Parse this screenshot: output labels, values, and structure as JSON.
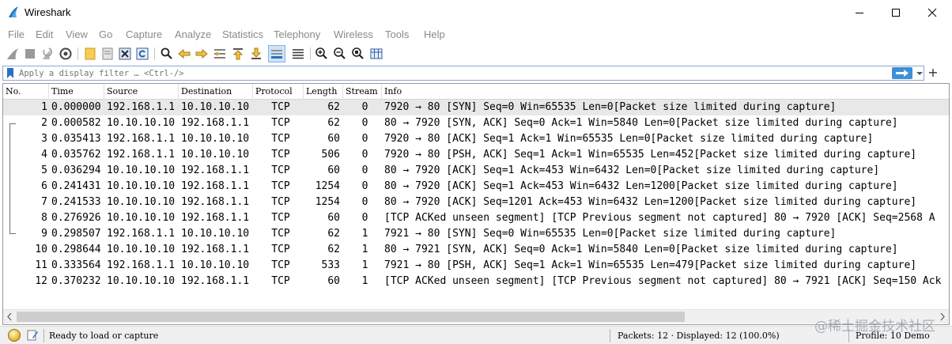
{
  "window": {
    "title": "Wireshark"
  },
  "menu": [
    "File",
    "Edit",
    "View",
    "Go",
    "Capture",
    "Analyze",
    "Statistics",
    "Telephony",
    "Wireless",
    "Tools",
    "Help"
  ],
  "filter": {
    "placeholder": "Apply a display filter … <Ctrl-/>",
    "add_label": "+"
  },
  "columns": {
    "no": "No.",
    "time": "Time",
    "source": "Source",
    "destination": "Destination",
    "protocol": "Protocol",
    "length": "Length",
    "stream": "Stream",
    "info": "Info"
  },
  "packets": [
    {
      "no": "1",
      "time": "0.000000",
      "src": "192.168.1.1",
      "dst": "10.10.10.10",
      "proto": "TCP",
      "len": "62",
      "stream": "0",
      "info": "7920 → 80 [SYN] Seq=0 Win=65535 Len=0[Packet size limited during capture]"
    },
    {
      "no": "2",
      "time": "0.000582",
      "src": "10.10.10.10",
      "dst": "192.168.1.1",
      "proto": "TCP",
      "len": "62",
      "stream": "0",
      "info": "80 → 7920 [SYN, ACK] Seq=0 Ack=1 Win=5840 Len=0[Packet size limited during capture]"
    },
    {
      "no": "3",
      "time": "0.035413",
      "src": "192.168.1.1",
      "dst": "10.10.10.10",
      "proto": "TCP",
      "len": "60",
      "stream": "0",
      "info": "7920 → 80 [ACK] Seq=1 Ack=1 Win=65535 Len=0[Packet size limited during capture]"
    },
    {
      "no": "4",
      "time": "0.035762",
      "src": "192.168.1.1",
      "dst": "10.10.10.10",
      "proto": "TCP",
      "len": "506",
      "stream": "0",
      "info": "7920 → 80 [PSH, ACK] Seq=1 Ack=1 Win=65535 Len=452[Packet size limited during capture]"
    },
    {
      "no": "5",
      "time": "0.036294",
      "src": "10.10.10.10",
      "dst": "192.168.1.1",
      "proto": "TCP",
      "len": "60",
      "stream": "0",
      "info": "80 → 7920 [ACK] Seq=1 Ack=453 Win=6432 Len=0[Packet size limited during capture]"
    },
    {
      "no": "6",
      "time": "0.241431",
      "src": "10.10.10.10",
      "dst": "192.168.1.1",
      "proto": "TCP",
      "len": "1254",
      "stream": "0",
      "info": "80 → 7920 [ACK] Seq=1 Ack=453 Win=6432 Len=1200[Packet size limited during capture]"
    },
    {
      "no": "7",
      "time": "0.241533",
      "src": "10.10.10.10",
      "dst": "192.168.1.1",
      "proto": "TCP",
      "len": "1254",
      "stream": "0",
      "info": "80 → 7920 [ACK] Seq=1201 Ack=453 Win=6432 Len=1200[Packet size limited during capture]"
    },
    {
      "no": "8",
      "time": "0.276926",
      "src": "10.10.10.10",
      "dst": "192.168.1.1",
      "proto": "TCP",
      "len": "60",
      "stream": "0",
      "info": "[TCP ACKed unseen segment] [TCP Previous segment not captured] 80 → 7920 [ACK] Seq=2568 A"
    },
    {
      "no": "9",
      "time": "0.298507",
      "src": "192.168.1.1",
      "dst": "10.10.10.10",
      "proto": "TCP",
      "len": "62",
      "stream": "1",
      "info": "7921 → 80 [SYN] Seq=0 Win=65535 Len=0[Packet size limited during capture]"
    },
    {
      "no": "10",
      "time": "0.298644",
      "src": "10.10.10.10",
      "dst": "192.168.1.1",
      "proto": "TCP",
      "len": "62",
      "stream": "1",
      "info": "80 → 7921 [SYN, ACK] Seq=0 Ack=1 Win=5840 Len=0[Packet size limited during capture]"
    },
    {
      "no": "11",
      "time": "0.333564",
      "src": "192.168.1.1",
      "dst": "10.10.10.10",
      "proto": "TCP",
      "len": "533",
      "stream": "1",
      "info": "7921 → 80 [PSH, ACK] Seq=1 Ack=1 Win=65535 Len=479[Packet size limited during capture]"
    },
    {
      "no": "12",
      "time": "0.370232",
      "src": "10.10.10.10",
      "dst": "192.168.1.1",
      "proto": "TCP",
      "len": "60",
      "stream": "1",
      "info": "[TCP ACKed unseen segment] [TCP Previous segment not captured] 80 → 7921 [ACK] Seq=150 Ack"
    }
  ],
  "status": {
    "ready": "Ready to load or capture",
    "packets": "Packets: 12 · Displayed: 12 (100.0%)",
    "profile": "Profile: 10 Demo"
  },
  "watermark": "@稀土掘金技术社区",
  "colors": {
    "selected_row": "#e8e8e8",
    "apply_button": "#3d8fd8",
    "menu_text": "#8a8a8a"
  }
}
